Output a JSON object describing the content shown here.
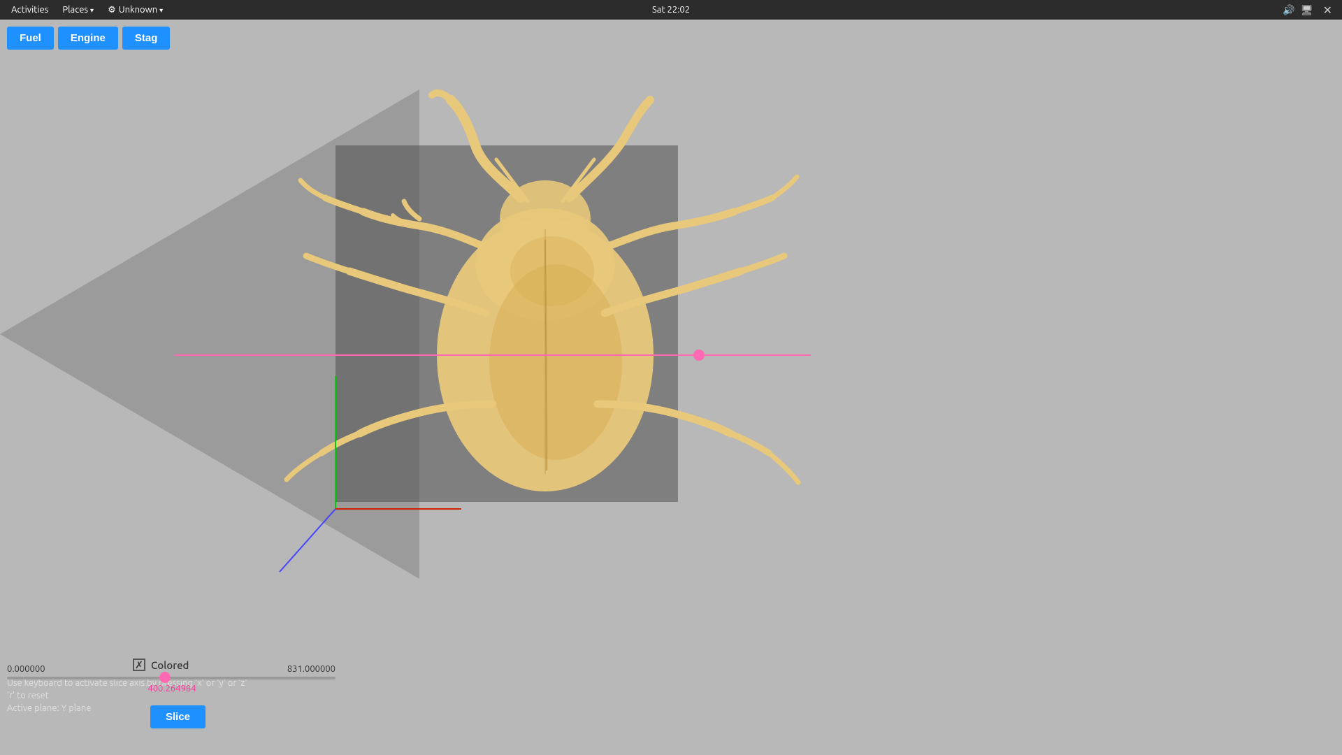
{
  "topbar": {
    "activities": "Activities",
    "places": "Places",
    "unknown": "Unknown",
    "datetime": "Sat 22:02",
    "close": "✕"
  },
  "toolbar": {
    "fuel_label": "Fuel",
    "engine_label": "Engine",
    "stag_label": "Stag"
  },
  "bottom": {
    "instruction": "Use keyboard to activate slice axis by pressing 'x' or 'y' or 'z'",
    "reset_hint": "'r' to reset",
    "active_plane": "Active plane: Y plane",
    "slider_min": "0.000000",
    "slider_max": "831.000000",
    "slider_value": "400.264984",
    "colored_label": "Colored",
    "slice_label": "Slice"
  }
}
